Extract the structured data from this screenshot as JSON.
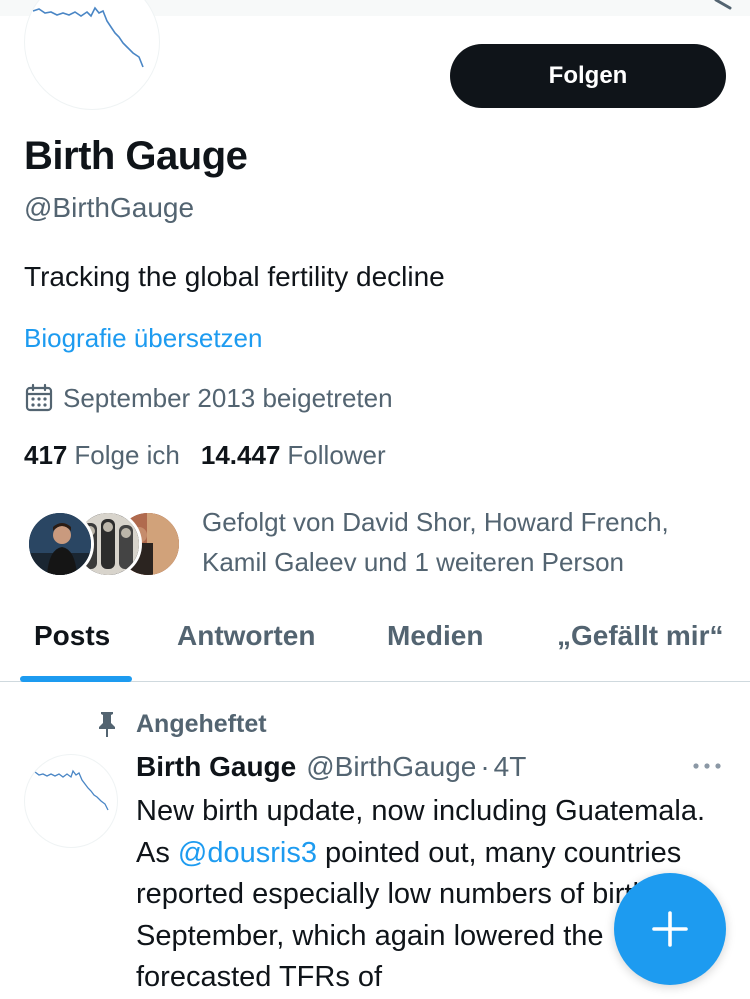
{
  "profile": {
    "name": "Birth Gauge",
    "handle": "@BirthGauge",
    "bio": "Tracking the global fertility decline",
    "translate_label": "Biografie übersetzen",
    "joined": "September 2013 beigetreten",
    "following_count": "417",
    "following_label": "Folge ich",
    "followers_count": "14.447",
    "followers_label": "Follower",
    "follow_button": "Folgen",
    "followed_by_line1": "Gefolgt von David Shor, Howard French,",
    "followed_by_line2": "Kamil Galeev und 1 weiteren Person"
  },
  "tabs": [
    {
      "label": "Posts",
      "active": true
    },
    {
      "label": "Antworten",
      "active": false
    },
    {
      "label": "Medien",
      "active": false
    },
    {
      "label": "„Gefällt mir“",
      "active": false
    }
  ],
  "post": {
    "pinned_label": "Angeheftet",
    "author_name": "Birth Gauge",
    "author_handle": "@BirthGauge",
    "separator": "·",
    "time": "4T",
    "text_before_mention": "New birth update, now including Guatemala. As ",
    "mention": "@dousris3",
    "text_after_mention": " pointed out, many countries reported especially low numbers of births in September, which again lowered the forecasted TFRs of"
  },
  "icons": {
    "calendar": "calendar-icon",
    "pin": "pin-icon",
    "more": "more-dots-icon",
    "compose": "plus-icon"
  },
  "colors": {
    "accent": "#1d9bf0",
    "text": "#0f1419",
    "secondary_text": "#536471",
    "button_dark": "#0f1419"
  }
}
